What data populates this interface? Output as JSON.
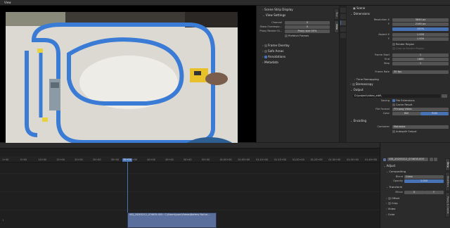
{
  "topbar": {
    "view_menu": "View"
  },
  "preview": {
    "description_alt": "",
    "floor_color": "#e8e5de",
    "track_color": "#3a7bd5"
  },
  "view_sidebar": {
    "scene_strip_display": "Scene Strip Display",
    "view_settings": "View Settings",
    "channel_label": "Channel",
    "channel_value": "0",
    "show_overexpo_label": "Show Overexpo...",
    "show_overexpo_value": "0",
    "proxy_render_label": "Proxy Render Si...",
    "proxy_render_value": "Proxy size 50%",
    "prefetch_frames": "Prefetch Frames",
    "frame_overlay": "Frame Overlay",
    "safe_areas": "Safe Areas",
    "annotations": "Annotations",
    "metadata": "Metadata",
    "tabs": [
      "Tool",
      "View"
    ]
  },
  "props": {
    "scene": "Scene",
    "dimensions": "Dimensions",
    "resolution_x_label": "Resolution X",
    "resolution_x": "3840 px",
    "resolution_y_label": "Y",
    "resolution_y": "2160 px",
    "percent": "100%",
    "aspect_x_label": "Aspect X",
    "aspect_x": "1.000",
    "aspect_y_label": "Y",
    "aspect_y": "1.000",
    "render_region": "Render Region",
    "crop_to_render_region": "Crop to Render Region",
    "frame_start_label": "Frame Start",
    "frame_start": "1",
    "end_label": "End",
    "end": "1800",
    "step_label": "Step",
    "step": "1",
    "frame_rate_label": "Frame Rate",
    "frame_rate": "30 fps",
    "time_remapping": "Time Remapping",
    "stereoscopy": "Stereoscopy",
    "output": "Output",
    "output_path": "D:\\project\\video_edit\\",
    "saving_label": "Saving",
    "file_extensions": "File Extensions",
    "cache_result": "Cache Result",
    "file_format_label": "File Format",
    "file_format": "FFmpeg Video",
    "color_label": "Color",
    "color_bw": "BW",
    "color_rgb": "RGB",
    "encoding": "Encoding",
    "container_label": "Container",
    "container": "Matroska",
    "autosplit": "Autosplit Output"
  },
  "sequencer": {
    "ticks": [
      "1+00",
      "5+00",
      "10+00",
      "15+00",
      "20+00",
      "25+00",
      "30+00",
      "35+00",
      "40+00",
      "45+00",
      "50+00",
      "55+00",
      "01:00+00",
      "01:05+00",
      "01:10+00",
      "01:15+00",
      "01:20+00",
      "01:25+00",
      "01:30+00",
      "01:35+00",
      "01:40+00"
    ],
    "playhead": "35+04",
    "strip_title": "VID_20203212_074635.003 : C:\\Users\\ryan\\Videos\\Battery Rail.m...",
    "channel_num": "1"
  },
  "strip_sidebar": {
    "strip_name": "VID_20203212_074635.003",
    "adjust": "Adjust",
    "compositing": "Compositing",
    "blend_label": "Blend",
    "blend_value": "Cross",
    "opacity_label": "Opacity",
    "opacity_value": "1.000",
    "transform": "Transform",
    "mirror_label": "Mirror",
    "mirror_x": "X",
    "mirror_y": "Y",
    "offset": "Offset",
    "crop": "Crop",
    "video": "Video",
    "color": "Color",
    "tabs": [
      "Strip",
      "Modifiers",
      "Proxy & Cache"
    ]
  }
}
